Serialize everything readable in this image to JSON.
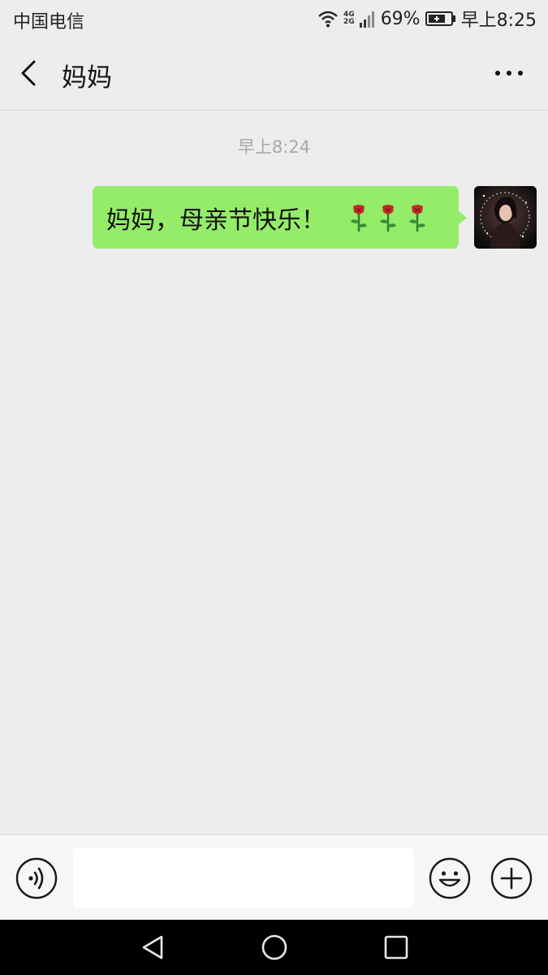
{
  "status_bar": {
    "carrier": "中国电信",
    "network_top": "4G",
    "network_bottom": "2G",
    "battery": "69%",
    "time": "早上8:25"
  },
  "header": {
    "title": "妈妈"
  },
  "chat": {
    "timestamp": "早上8:24",
    "messages": [
      {
        "sender": "me",
        "text": "妈妈，母亲节快乐！",
        "emoji": [
          "rose-icon",
          "rose-icon",
          "rose-icon"
        ],
        "bubble_color": "#95ec69"
      }
    ]
  },
  "input_bar": {
    "value": "",
    "placeholder": ""
  },
  "icons": {
    "back": "chevron-left-icon",
    "more": "more-dots-icon",
    "voice": "voice-icon",
    "emoji": "emoji-icon",
    "plus": "plus-icon",
    "nav_back": "triangle-back-icon",
    "nav_home": "circle-home-icon",
    "nav_recent": "square-recent-icon"
  },
  "colors": {
    "background": "#ededed",
    "bubble": "#95ec69",
    "timestamp": "#a8a8a8",
    "navbar": "#000000"
  }
}
